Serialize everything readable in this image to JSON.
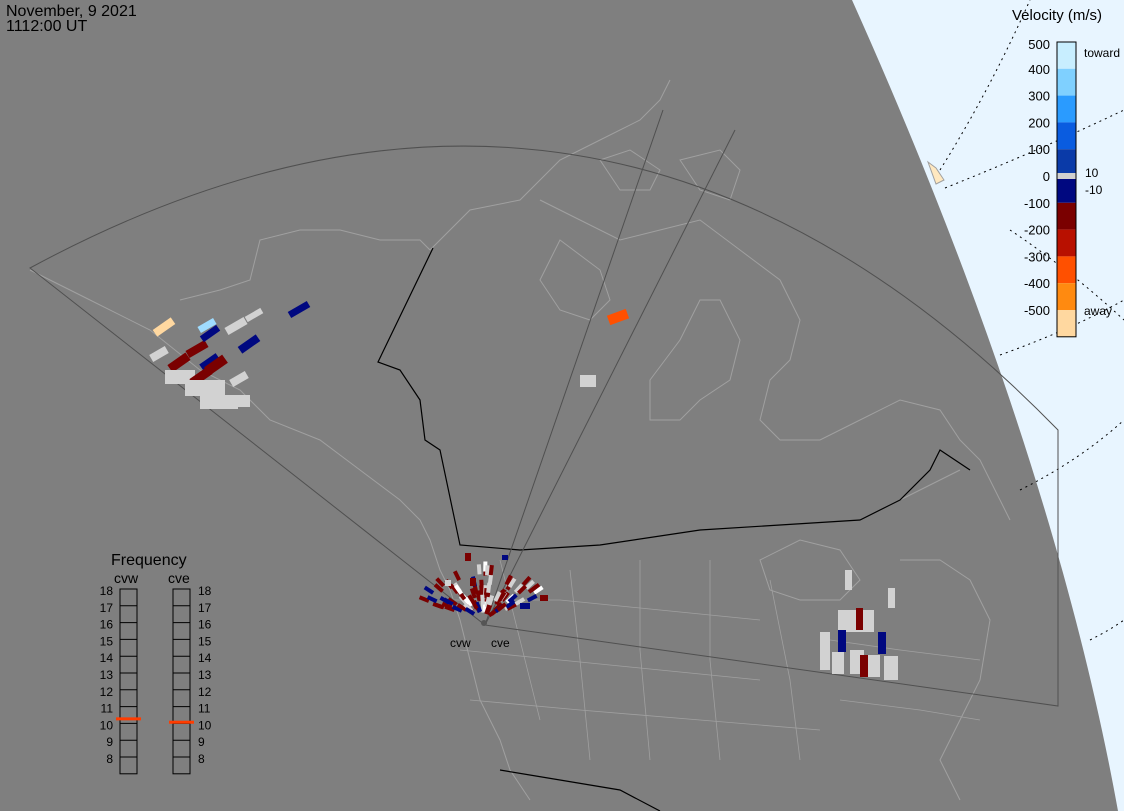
{
  "header": {
    "date": "November, 9 2021",
    "time": "1112:00 UT"
  },
  "colors": {
    "ocean_light": "#e8f5ff",
    "background": "#7f7f7f",
    "land_line": "#a0a0a0",
    "ground_scatter": "#d2d2d2",
    "frequency_marker": "#ff3c00"
  },
  "velocity_scale": {
    "title": "Velocity (m/s)",
    "ticks": [
      "500",
      "400",
      "300",
      "200",
      "100",
      "0",
      "-100",
      "-200",
      "-300",
      "-400",
      "-500"
    ],
    "inner_pos": "10",
    "inner_neg": "-10",
    "toward_label": "toward",
    "away_label": "away",
    "colors": [
      "#c8eeff",
      "#7fd0ff",
      "#2a9bff",
      "#0a5ce0",
      "#0a3aa8",
      "#000880",
      "#7a0000",
      "#b81000",
      "#ff5000",
      "#ff8a10",
      "#ffd8a0"
    ]
  },
  "frequency": {
    "title": "Frequency",
    "radars": [
      {
        "code": "cvw",
        "frequency_mhz": 10.8
      },
      {
        "code": "cve",
        "frequency_mhz": 10.6
      }
    ],
    "ticks": [
      "18",
      "17",
      "16",
      "15",
      "14",
      "13",
      "12",
      "11",
      "10",
      "9",
      "8"
    ]
  },
  "radar_labels": {
    "cvw": "cvw",
    "cve": "cve"
  }
}
